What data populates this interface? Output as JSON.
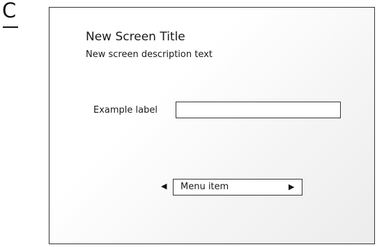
{
  "panel_letter": "C",
  "screen": {
    "title": "New Screen Title",
    "description": "New screen description text",
    "field": {
      "label": "Example label",
      "value": "",
      "placeholder": ""
    },
    "menu": {
      "selected": "Menu item",
      "left_arrow_icon": "triangle-left-icon",
      "right_arrow_icon": "triangle-right-icon"
    }
  }
}
